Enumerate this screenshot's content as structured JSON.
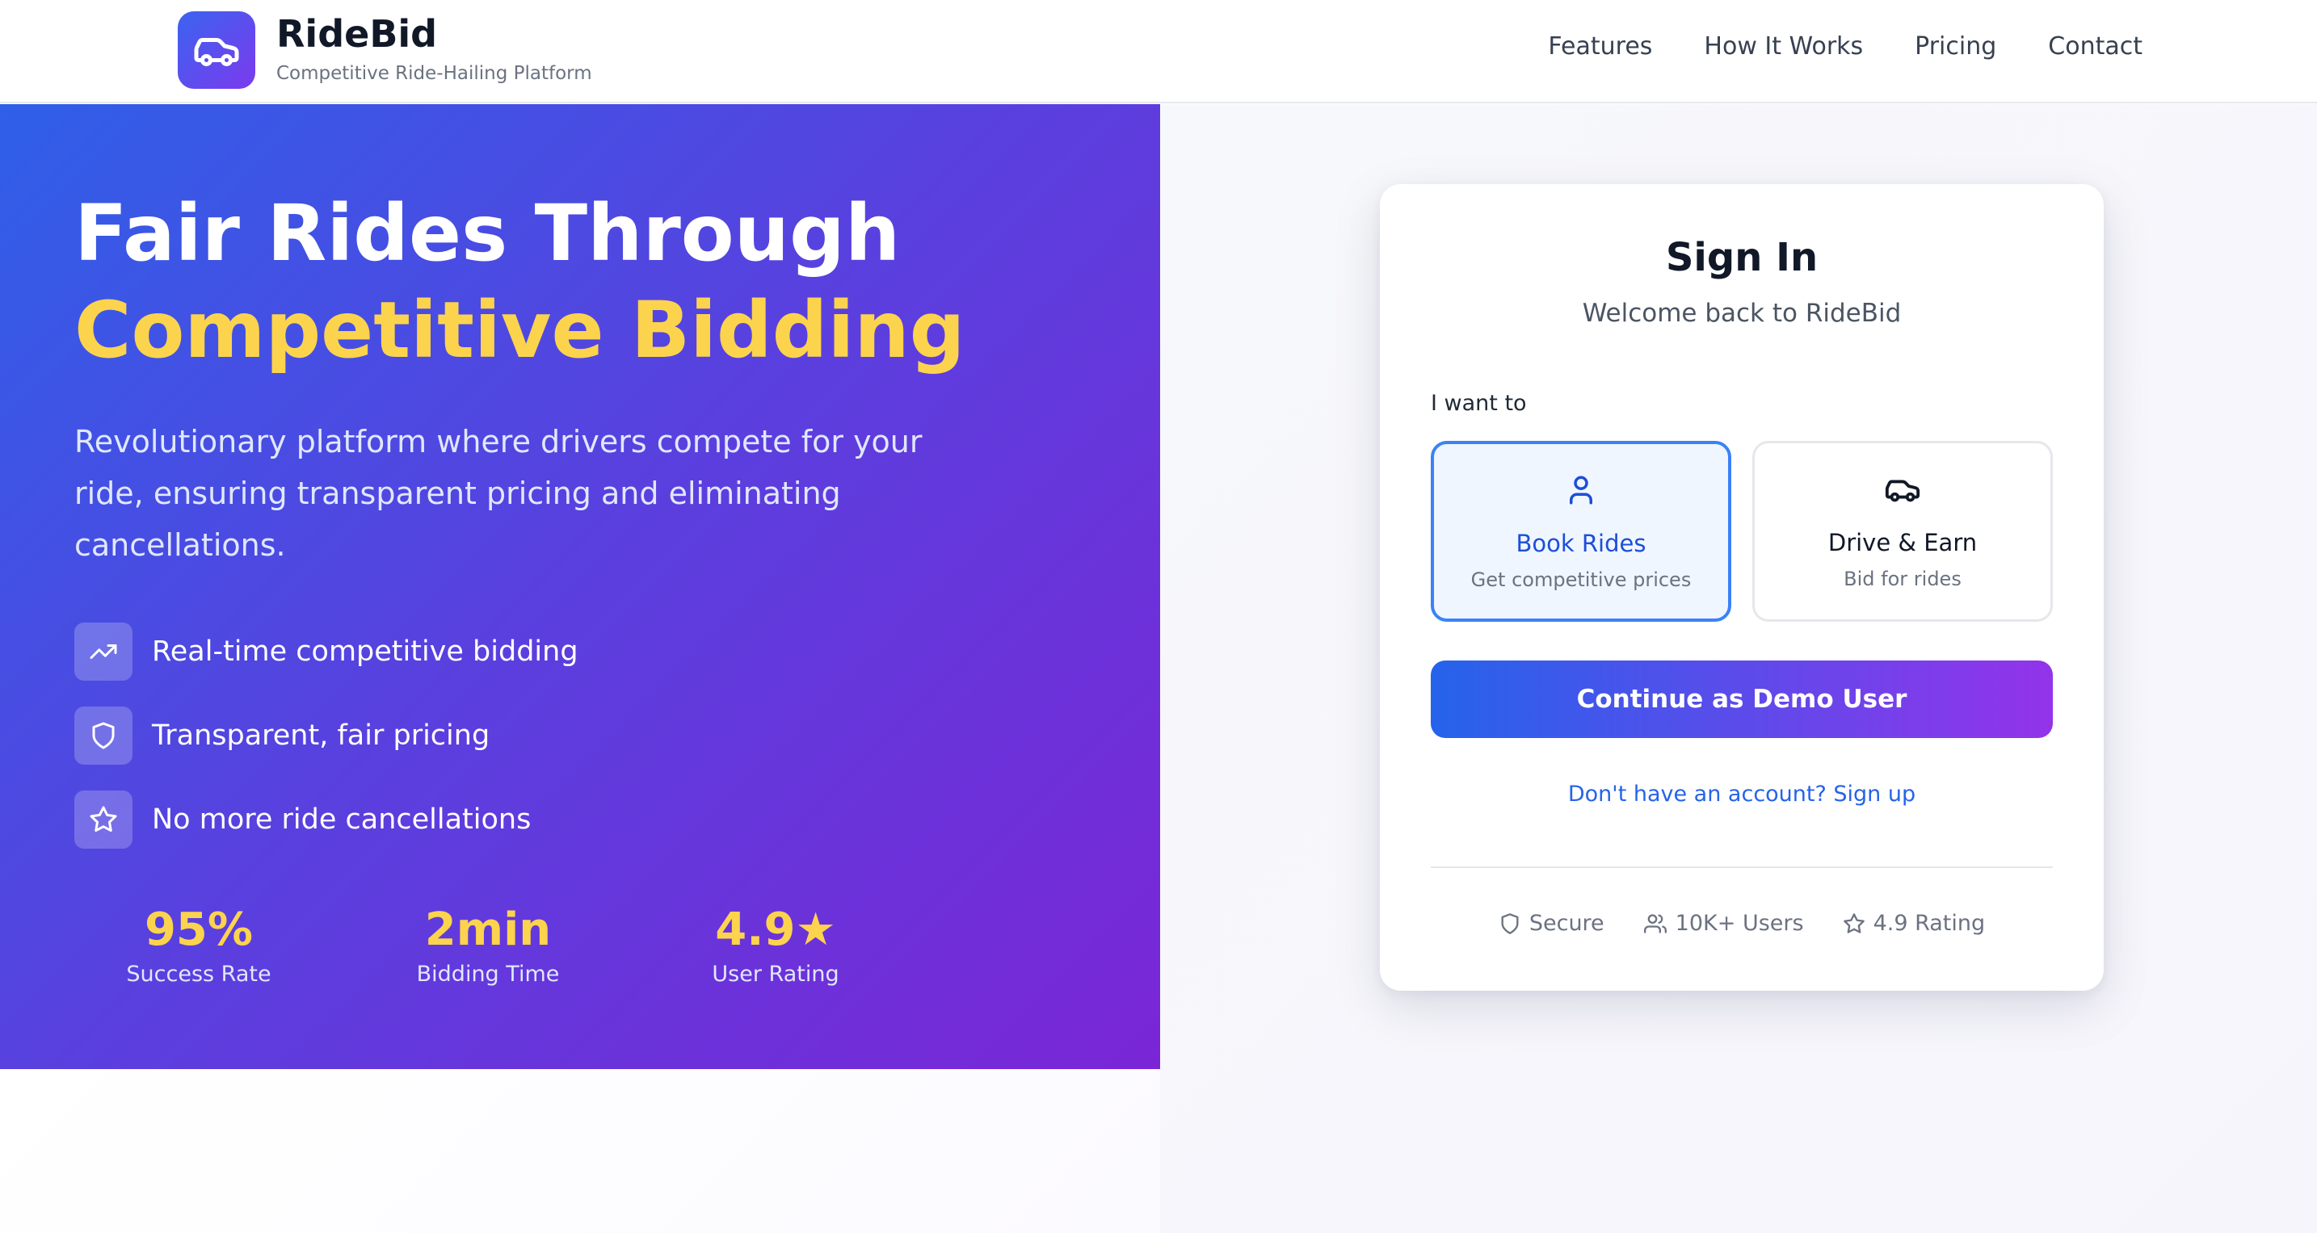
{
  "header": {
    "brand_name": "RideBid",
    "brand_tagline": "Competitive Ride-Hailing Platform",
    "logo_icon": "car-icon",
    "nav": [
      "Features",
      "How It Works",
      "Pricing",
      "Contact"
    ]
  },
  "hero": {
    "title_line1": "Fair Rides Through",
    "title_line2": "Competitive Bidding",
    "description": "Revolutionary platform where drivers compete for your ride, ensuring transparent pricing and eliminating cancellations.",
    "features": [
      {
        "icon": "trending-up-icon",
        "text": "Real-time competitive bidding"
      },
      {
        "icon": "shield-icon",
        "text": "Transparent, fair pricing"
      },
      {
        "icon": "star-icon",
        "text": "No more ride cancellations"
      }
    ],
    "stats": [
      {
        "value": "95%",
        "label": "Success Rate"
      },
      {
        "value": "2min",
        "label": "Bidding Time"
      },
      {
        "value": "4.9★",
        "label": "User Rating"
      }
    ]
  },
  "signin": {
    "title": "Sign In",
    "subtitle": "Welcome back to RideBid",
    "role_label": "I want to",
    "roles": [
      {
        "icon": "user-icon",
        "title": "Book Rides",
        "desc": "Get competitive prices",
        "selected": true
      },
      {
        "icon": "car-icon",
        "title": "Drive & Earn",
        "desc": "Bid for rides",
        "selected": false
      }
    ],
    "demo_button": "Continue as Demo User",
    "signup_link": "Don't have an account? Sign up",
    "badges": [
      {
        "icon": "shield-icon",
        "text": "Secure"
      },
      {
        "icon": "users-icon",
        "text": "10K+ Users"
      },
      {
        "icon": "star-icon",
        "text": "4.9 Rating"
      }
    ]
  },
  "colors": {
    "hero_gradient_start": "#2f5fe8",
    "hero_gradient_end": "#7a26d6",
    "highlight_yellow": "#fcd34d",
    "primary_blue": "#2563eb",
    "primary_purple": "#9333ea"
  }
}
